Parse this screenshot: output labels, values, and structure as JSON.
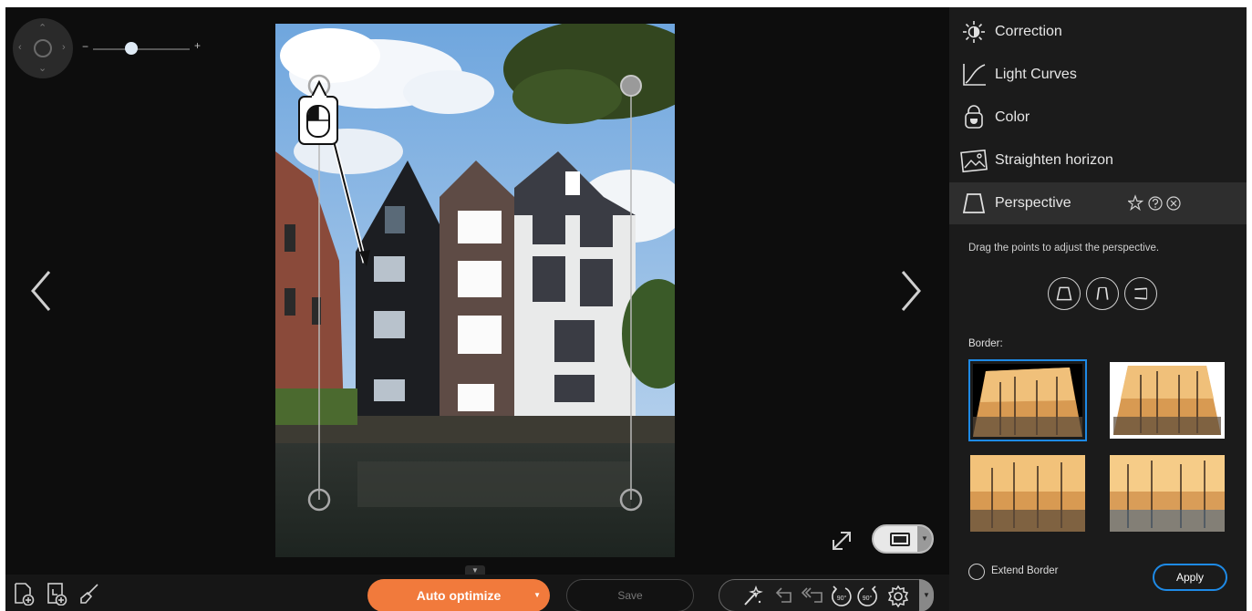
{
  "zoom": {
    "minus": "−",
    "plus": "+",
    "level": 0.4
  },
  "menu": [
    {
      "label": "Correction",
      "icon": "sun-icon"
    },
    {
      "label": "Light Curves",
      "icon": "curve-icon"
    },
    {
      "label": "Color",
      "icon": "palette-bucket-icon"
    },
    {
      "label": "Straighten horizon",
      "icon": "landscape-icon"
    },
    {
      "label": "Perspective",
      "icon": "trapezoid-icon",
      "active": true
    }
  ],
  "perspective": {
    "hint": "Drag the points to adjust the perspective.",
    "border_label": "Border:",
    "extend_border": "Extend Border",
    "apply": "Apply"
  },
  "bottom": {
    "auto_optimize": "Auto optimize",
    "save": "Save",
    "rotate_left_label": "90°",
    "rotate_right_label": "90°"
  },
  "colors": {
    "accent": "#1e8ae6",
    "auto_optimize": "#f17a3c",
    "panel": "#1b1b1b",
    "canvas": "#0d0d0d"
  }
}
